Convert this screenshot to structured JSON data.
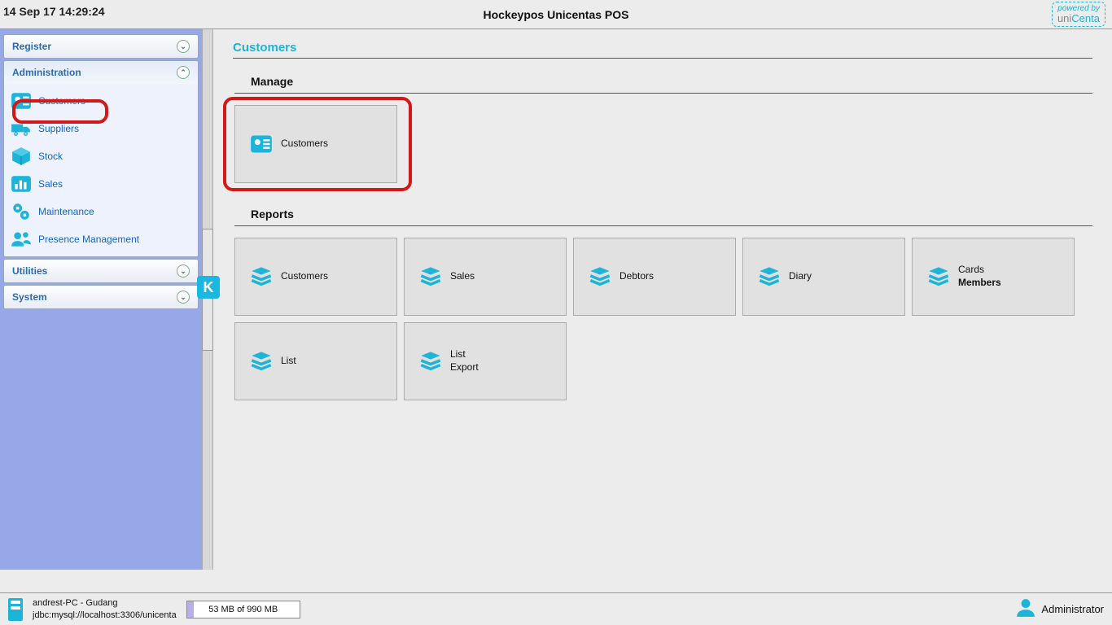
{
  "header": {
    "datetime": "14 Sep 17 14:29:24",
    "title": "Hockeypos Unicentas POS",
    "powered_by": "powered by",
    "brand_uni": "uni",
    "brand_centa": "Centa"
  },
  "sidebar": {
    "register": {
      "label": "Register"
    },
    "administration": {
      "label": "Administration",
      "items": [
        {
          "label": "Customers"
        },
        {
          "label": "Suppliers"
        },
        {
          "label": "Stock"
        },
        {
          "label": "Sales"
        },
        {
          "label": "Maintenance"
        },
        {
          "label": "Presence Management"
        }
      ]
    },
    "utilities": {
      "label": "Utilities"
    },
    "system": {
      "label": "System"
    }
  },
  "divider_logo": "K",
  "main": {
    "page_title": "Customers",
    "manage": {
      "title": "Manage",
      "cards": [
        {
          "label": "Customers"
        }
      ]
    },
    "reports": {
      "title": "Reports",
      "cards": [
        {
          "label": "Customers"
        },
        {
          "label": "Sales"
        },
        {
          "label": "Debtors"
        },
        {
          "label": "Diary"
        },
        {
          "label": "Cards",
          "sub": "Members"
        },
        {
          "label": "List"
        },
        {
          "label": "List",
          "sub": "Export"
        }
      ]
    }
  },
  "footer": {
    "host_line1": "andrest-PC - Gudang",
    "host_line2": "jdbc:mysql://localhost:3306/unicenta",
    "memory": "53 MB of 990 MB",
    "user": "Administrator"
  }
}
